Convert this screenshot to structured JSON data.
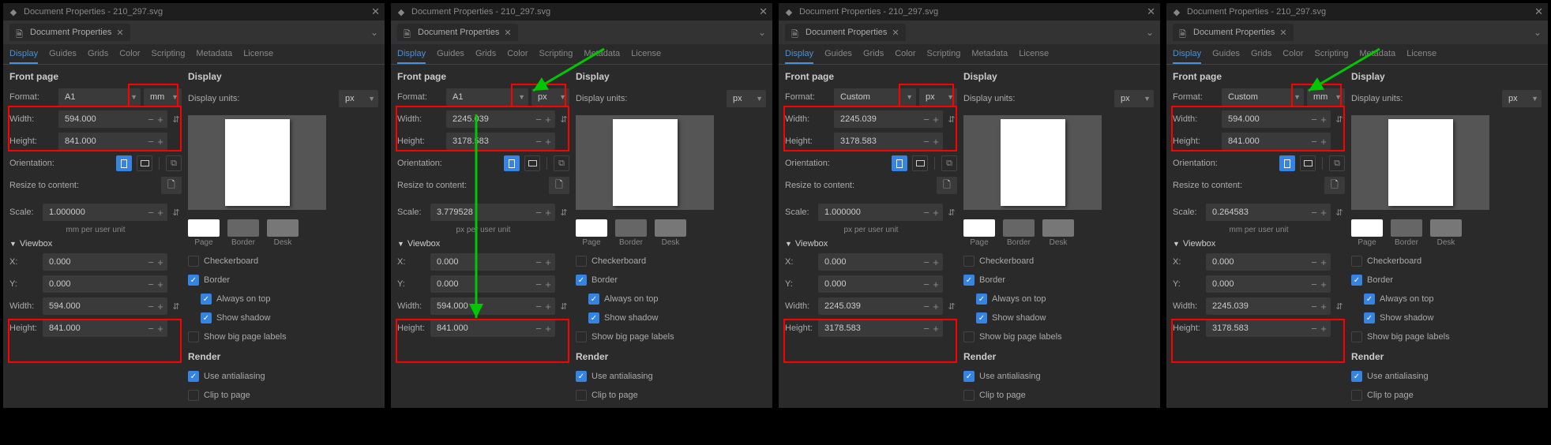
{
  "windows": [
    {
      "title": "Document Properties - 210_297.svg",
      "dock_tab": "Document Properties",
      "tabs": {
        "display": "Display",
        "guides": "Guides",
        "grids": "Grids",
        "color": "Color",
        "scripting": "Scripting",
        "metadata": "Metadata",
        "license": "License"
      },
      "front_page_title": "Front page",
      "format_label": "Format:",
      "format_value": "A1",
      "unit_value": "mm",
      "width_label": "Width:",
      "width_value": "594.000",
      "height_label": "Height:",
      "height_value": "841.000",
      "orientation_label": "Orientation:",
      "resize_label": "Resize to content:",
      "scale_label": "Scale:",
      "scale_value": "1.000000",
      "unit_note": "mm  per user unit",
      "viewbox_title": "Viewbox",
      "x_label": "X:",
      "x_value": "0.000",
      "y_label": "Y:",
      "y_value": "0.000",
      "vb_width_label": "Width:",
      "vb_width_value": "594.000",
      "vb_height_label": "Height:",
      "vb_height_value": "841.000",
      "display_title": "Display",
      "display_units_label": "Display units:",
      "display_units_value": "px",
      "swatch": {
        "page": "Page",
        "border": "Border",
        "desk": "Desk"
      },
      "checkerboard": "Checkerboard",
      "border": "Border",
      "always_on_top": "Always on top",
      "show_shadow": "Show shadow",
      "show_big_page_labels": "Show big page labels",
      "render_title": "Render",
      "use_antialiasing": "Use antialiasing",
      "clip_to_page": "Clip to page",
      "highlights": {
        "unit_box": true
      }
    },
    {
      "title": "Document Properties - 210_297.svg",
      "dock_tab": "Document Properties",
      "tabs": {
        "display": "Display",
        "guides": "Guides",
        "grids": "Grids",
        "color": "Color",
        "scripting": "Scripting",
        "metadata": "Metadata",
        "license": "License"
      },
      "front_page_title": "Front page",
      "format_label": "Format:",
      "format_value": "A1",
      "unit_value": "px",
      "width_label": "Width:",
      "width_value": "2245.039",
      "height_label": "Height:",
      "height_value": "3178.583",
      "orientation_label": "Orientation:",
      "resize_label": "Resize to content:",
      "scale_label": "Scale:",
      "scale_value": "3.779528",
      "unit_note": "px  per user unit",
      "viewbox_title": "Viewbox",
      "x_label": "X:",
      "x_value": "0.000",
      "y_label": "Y:",
      "y_value": "0.000",
      "vb_width_label": "Width:",
      "vb_width_value": "594.000",
      "vb_height_label": "Height:",
      "vb_height_value": "841.000",
      "display_title": "Display",
      "display_units_label": "Display units:",
      "display_units_value": "px",
      "swatch": {
        "page": "Page",
        "border": "Border",
        "desk": "Desk"
      },
      "checkerboard": "Checkerboard",
      "border": "Border",
      "always_on_top": "Always on top",
      "show_shadow": "Show shadow",
      "show_big_page_labels": "Show big page labels",
      "render_title": "Render",
      "use_antialiasing": "Use antialiasing",
      "clip_to_page": "Clip to page"
    },
    {
      "title": "Document Properties - 210_297.svg",
      "dock_tab": "Document Properties",
      "tabs": {
        "display": "Display",
        "guides": "Guides",
        "grids": "Grids",
        "color": "Color",
        "scripting": "Scripting",
        "metadata": "Metadata",
        "license": "License"
      },
      "front_page_title": "Front page",
      "format_label": "Format:",
      "format_value": "Custom",
      "unit_value": "px",
      "width_label": "Width:",
      "width_value": "2245.039",
      "height_label": "Height:",
      "height_value": "3178.583",
      "orientation_label": "Orientation:",
      "resize_label": "Resize to content:",
      "scale_label": "Scale:",
      "scale_value": "1.000000",
      "unit_note": "px  per user unit",
      "viewbox_title": "Viewbox",
      "x_label": "X:",
      "x_value": "0.000",
      "y_label": "Y:",
      "y_value": "0.000",
      "vb_width_label": "Width:",
      "vb_width_value": "2245.039",
      "vb_height_label": "Height:",
      "vb_height_value": "3178.583",
      "display_title": "Display",
      "display_units_label": "Display units:",
      "display_units_value": "px",
      "swatch": {
        "page": "Page",
        "border": "Border",
        "desk": "Desk"
      },
      "checkerboard": "Checkerboard",
      "border": "Border",
      "always_on_top": "Always on top",
      "show_shadow": "Show shadow",
      "show_big_page_labels": "Show big page labels",
      "render_title": "Render",
      "use_antialiasing": "Use antialiasing",
      "clip_to_page": "Clip to page"
    },
    {
      "title": "Document Properties - 210_297.svg",
      "dock_tab": "Document Properties",
      "tabs": {
        "display": "Display",
        "guides": "Guides",
        "grids": "Grids",
        "color": "Color",
        "scripting": "Scripting",
        "metadata": "Metadata",
        "license": "License"
      },
      "front_page_title": "Front page",
      "format_label": "Format:",
      "format_value": "Custom",
      "unit_value": "mm",
      "width_label": "Width:",
      "width_value": "594.000",
      "height_label": "Height:",
      "height_value": "841.000",
      "orientation_label": "Orientation:",
      "resize_label": "Resize to content:",
      "scale_label": "Scale:",
      "scale_value": "0.264583",
      "unit_note": "mm  per user unit",
      "viewbox_title": "Viewbox",
      "x_label": "X:",
      "x_value": "0.000",
      "y_label": "Y:",
      "y_value": "0.000",
      "vb_width_label": "Width:",
      "vb_width_value": "2245.039",
      "vb_height_label": "Height:",
      "vb_height_value": "3178.583",
      "display_title": "Display",
      "display_units_label": "Display units:",
      "display_units_value": "px",
      "swatch": {
        "page": "Page",
        "border": "Border",
        "desk": "Desk"
      },
      "checkerboard": "Checkerboard",
      "border": "Border",
      "always_on_top": "Always on top",
      "show_shadow": "Show shadow",
      "show_big_page_labels": "Show big page labels",
      "render_title": "Render",
      "use_antialiasing": "Use antialiasing",
      "clip_to_page": "Clip to page"
    }
  ]
}
